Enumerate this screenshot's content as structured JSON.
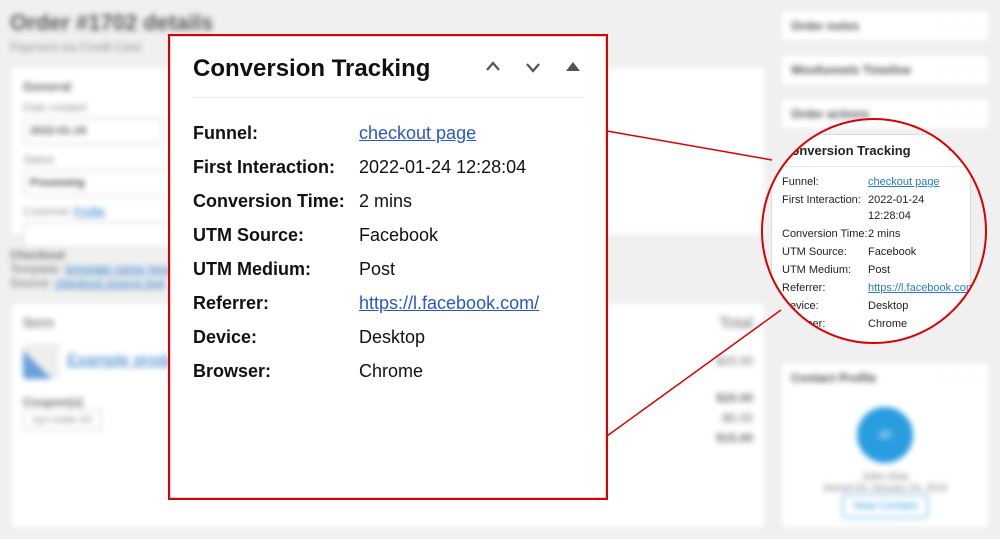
{
  "order": {
    "title": "Order #1702 details",
    "subtitle": "Payment via Credit Card",
    "date": "2022-01-24",
    "status": "Processing"
  },
  "side_panels": {
    "notes": "Order notes",
    "timeline": "Woofunnels Timeline",
    "actions": "Order actions",
    "contact": "Contact Profile",
    "contact_name": "John Doe",
    "contact_joined": "Joined On January 24, 2022",
    "contact_btn": "View Contact"
  },
  "tracking": {
    "title": "Conversion Tracking",
    "rows": [
      {
        "k": "Funnel:",
        "v": "checkout page",
        "link": true
      },
      {
        "k": "First Interaction:",
        "v": "2022-01-24 12:28:04"
      },
      {
        "k": "Conversion Time:",
        "v": "2 mins"
      },
      {
        "k": "UTM Source:",
        "v": "Facebook"
      },
      {
        "k": "UTM Medium:",
        "v": "Post"
      },
      {
        "k": "Referrer:",
        "v": "https://l.facebook.com/",
        "link": true
      },
      {
        "k": "Device:",
        "v": "Desktop"
      },
      {
        "k": "Browser:",
        "v": "Chrome"
      }
    ]
  }
}
